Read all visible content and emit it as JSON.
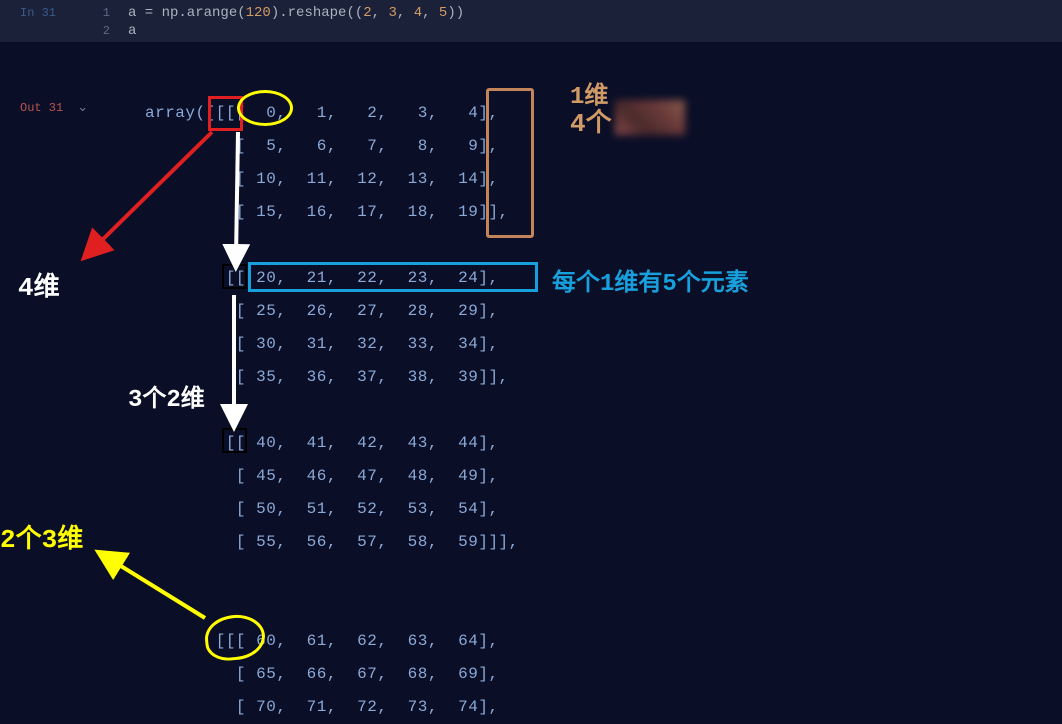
{
  "cell": {
    "in_label": "In 31",
    "line1_num": "1",
    "line2_num": "2",
    "code_line1_prefix": "a = np.arange(",
    "code_line1_arg": "120",
    "code_line1_mid": ").reshape((",
    "code_line1_d1": "2",
    "code_line1_d2": "3",
    "code_line1_d3": "4",
    "code_line1_d4": "5",
    "code_line1_suffix": "))",
    "code_line2": "a"
  },
  "output": {
    "out_label": "Out 31",
    "array_text": "array([[[[  0,   1,   2,   3,   4],\n         [  5,   6,   7,   8,   9],\n         [ 10,  11,  12,  13,  14],\n         [ 15,  16,  17,  18,  19]],\n\n        [[ 20,  21,  22,  23,  24],\n         [ 25,  26,  27,  28,  29],\n         [ 30,  31,  32,  33,  34],\n         [ 35,  36,  37,  38,  39]],\n\n        [[ 40,  41,  42,  43,  44],\n         [ 45,  46,  47,  48,  49],\n         [ 50,  51,  52,  53,  54],\n         [ 55,  56,  57,  58,  59]]],\n\n\n       [[[ 60,  61,  62,  63,  64],\n         [ 65,  66,  67,  68,  69],\n         [ 70,  71,  72,  73,  74],"
  },
  "annotations": {
    "label_4d": "4维",
    "label_3x2d": "3个2维",
    "label_2x3d": "2个3维",
    "label_1d_row": "1维",
    "label_4x": "4个",
    "label_1d_5elem": "每个1维有5个元素"
  }
}
